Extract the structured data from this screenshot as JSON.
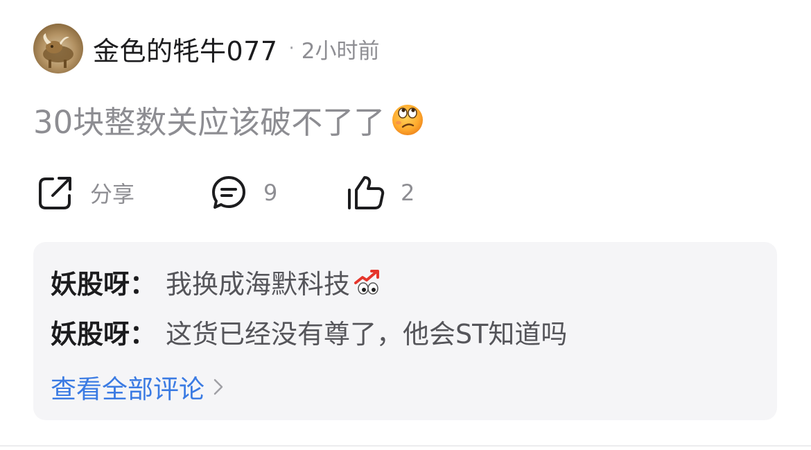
{
  "post": {
    "author": {
      "name": "金色的牦牛077",
      "avatar_icon": "golden-bull-avatar"
    },
    "separator": "·",
    "time": "2小时前",
    "content": "30块整数关应该破不了了",
    "content_emoji": "thinking-eyes-up-emoji"
  },
  "actions": {
    "share": {
      "icon": "share-icon",
      "label": "分享"
    },
    "comment": {
      "icon": "comment-icon",
      "count": "9"
    },
    "like": {
      "icon": "thumbs-up-icon",
      "count": "2"
    }
  },
  "comments": [
    {
      "author": "妖股呀：",
      "text": "我换成海默科技",
      "emoji": "chart-up-eyes-emoji"
    },
    {
      "author": "妖股呀：",
      "text": "这货已经没有尊了，他会ST知道吗"
    }
  ],
  "view_all": {
    "label": "查看全部评论",
    "icon": "chevron-right-icon"
  },
  "colors": {
    "primary_text": "#1c1c1e",
    "secondary_text": "#8e8e93",
    "link": "#3b7be3",
    "comment_bg": "#f5f5f7"
  }
}
